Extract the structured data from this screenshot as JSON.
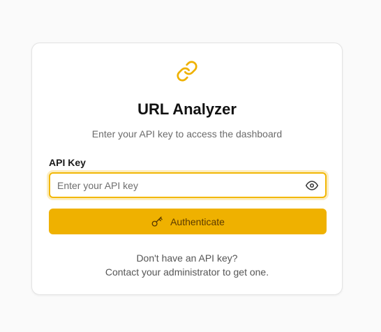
{
  "app": {
    "title": "URL Analyzer",
    "subtitle": "Enter your API key to access the dashboard",
    "logo_icon": "link-icon",
    "accent_color": "#efb100"
  },
  "form": {
    "api_key_label": "API Key",
    "api_key_placeholder": "Enter your API key",
    "api_key_value": "",
    "toggle_icon": "eye-icon",
    "submit_icon": "key-icon",
    "submit_label": "Authenticate"
  },
  "footer": {
    "line1": "Don't have an API key?",
    "line2": "Contact your administrator to get one."
  }
}
